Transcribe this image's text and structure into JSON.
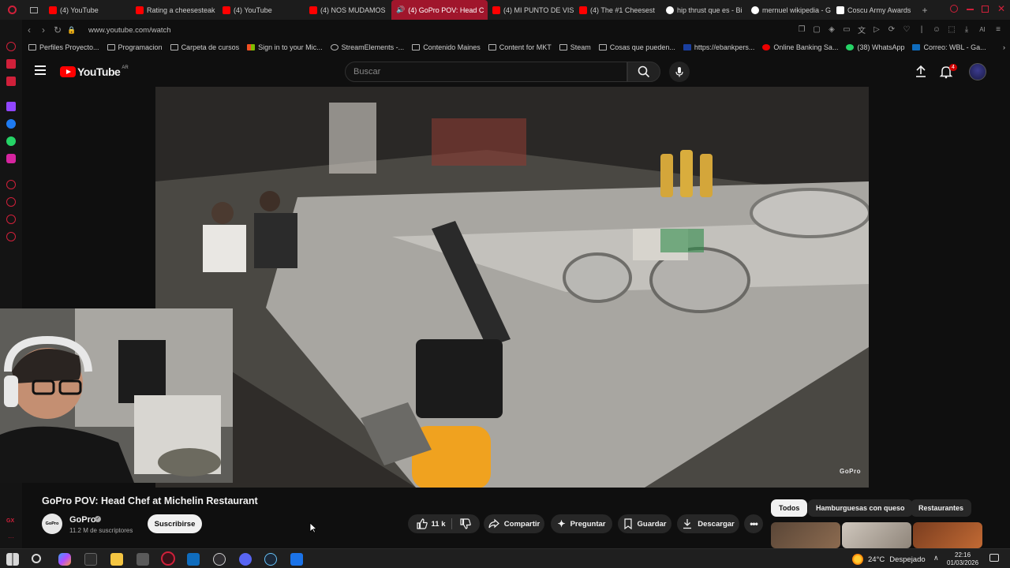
{
  "tabs": [
    {
      "label": "(4) YouTube",
      "color": "#ff0000"
    },
    {
      "label": "Rating a cheesesteak",
      "color": "#ff0000"
    },
    {
      "label": "(4) YouTube",
      "color": "#ff0000"
    },
    {
      "label": "(4) NOS MUDAMOS",
      "color": "#ff0000"
    },
    {
      "label": "(4) GoPro POV: Head C",
      "color": "#ff0000",
      "active": true
    },
    {
      "label": "(4) MI PUNTO DE VIS",
      "color": "#ff0000"
    },
    {
      "label": "(4) The #1 Cheesest",
      "color": "#ff0000"
    },
    {
      "label": "hip thrust que es - Bi",
      "color": "#4285f4"
    },
    {
      "label": "mernuel wikipedia - G",
      "color": "#4285f4"
    },
    {
      "label": "Coscu Army Awards",
      "color": "#ffffff"
    }
  ],
  "address": {
    "url": "www.youtube.com/watch"
  },
  "bookmarks": [
    "Perfiles Proyecto...",
    "Programacion",
    "Carpeta de cursos",
    "Sign in to your Mic...",
    "StreamElements -...",
    "Contenido Maines",
    "Content for MKT",
    "Steam",
    "Cosas que pueden...",
    "https://ebankpers...",
    "Online Banking Sa...",
    "(38) WhatsApp",
    "Correo: WBL - Ga..."
  ],
  "header": {
    "logo_text": "YouTube",
    "country_code": "AR",
    "search_placeholder": "Buscar",
    "notifications_count": "4"
  },
  "video": {
    "watermark": "GoPro",
    "title": "GoPro POV: Head Chef at Michelin Restaurant"
  },
  "channel": {
    "avatar_text": "GoPro",
    "name": "GoPro",
    "subscribers": "11.2 M de suscriptores",
    "subscribe_label": "Suscribirse"
  },
  "actions": {
    "likes": "11 k",
    "share": "Compartir",
    "ask": "Preguntar",
    "save": "Guardar",
    "download": "Descargar"
  },
  "chips": [
    "Todos",
    "Hamburguesas con queso",
    "Restaurantes"
  ],
  "taskbar": {
    "temperature": "24°C",
    "weather": "Despejado",
    "time": "22:16",
    "date": "01/03/2026"
  }
}
